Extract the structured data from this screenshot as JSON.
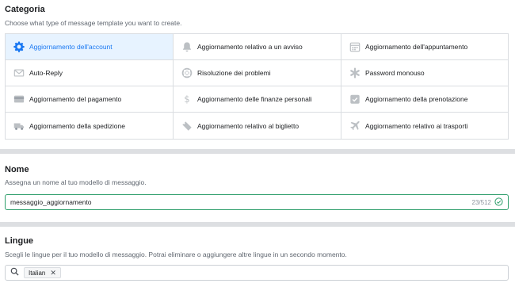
{
  "categoria": {
    "title": "Categoria",
    "subtitle": "Choose what type of message template you want to create.",
    "items": [
      {
        "label": "Aggiornamento dell'account",
        "icon": "gear-icon",
        "selected": true
      },
      {
        "label": "Aggiornamento relativo a un avviso",
        "icon": "bell-icon",
        "selected": false
      },
      {
        "label": "Aggiornamento dell'appuntamento",
        "icon": "calendar-icon",
        "selected": false
      },
      {
        "label": "Auto-Reply",
        "icon": "envelope-icon",
        "selected": false
      },
      {
        "label": "Risoluzione dei problemi",
        "icon": "lifebuoy-icon",
        "selected": false
      },
      {
        "label": "Password monouso",
        "icon": "asterisk-icon",
        "selected": false
      },
      {
        "label": "Aggiornamento del pagamento",
        "icon": "credit-card-icon",
        "selected": false
      },
      {
        "label": "Aggiornamento delle finanze personali",
        "icon": "dollar-icon",
        "selected": false
      },
      {
        "label": "Aggiornamento della prenotazione",
        "icon": "calendar-check-icon",
        "selected": false
      },
      {
        "label": "Aggiornamento della spedizione",
        "icon": "truck-icon",
        "selected": false
      },
      {
        "label": "Aggiornamento relativo al biglietto",
        "icon": "ticket-icon",
        "selected": false
      },
      {
        "label": "Aggiornamento relativo ai trasporti",
        "icon": "airplane-icon",
        "selected": false
      }
    ]
  },
  "nome": {
    "title": "Nome",
    "subtitle": "Assegna un nome al tuo modello di messaggio.",
    "value": "messaggio_aggiornamento",
    "counter": "23/512"
  },
  "lingue": {
    "title": "Lingue",
    "subtitle": "Scegli le lingue per il tuo modello di messaggio. Potrai eliminare o aggiungere altre lingue in un secondo momento.",
    "chip": "Italian",
    "chip_remove": "✕"
  },
  "colors": {
    "accent": "#1877f2",
    "selected_bg": "#e7f3ff",
    "valid": "#2e9e6b",
    "icon_gray": "#bcc0c4"
  }
}
